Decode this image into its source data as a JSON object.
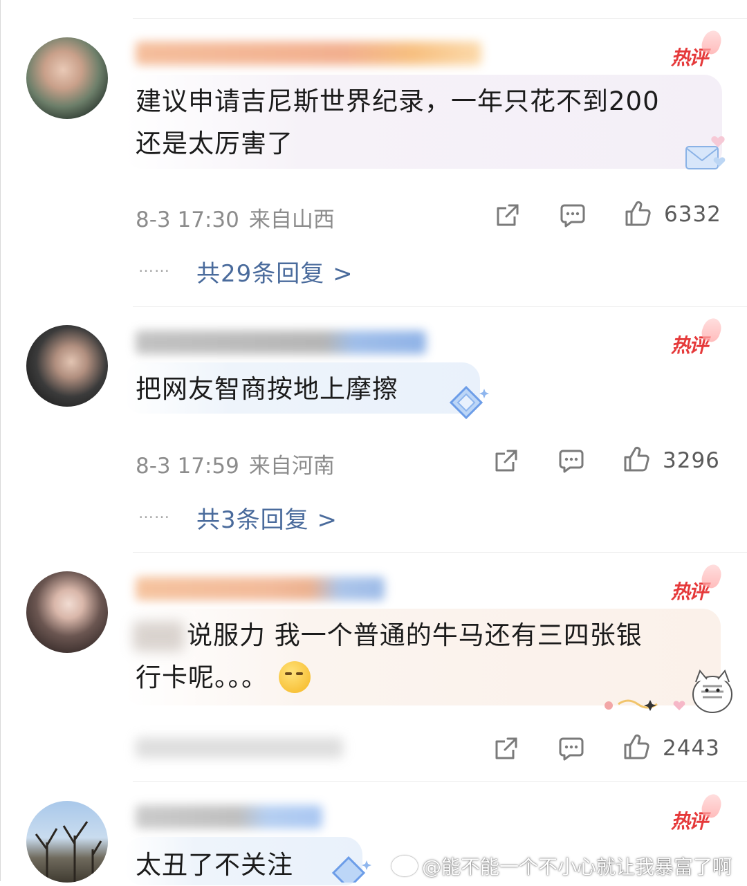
{
  "colors": {
    "hot_badge": "#e5393a",
    "reply_link": "#4a6b9c",
    "meta_text": "#8c8c8c"
  },
  "comments": [
    {
      "hot_label": "热评",
      "text": "建议申请吉尼斯世界纪录，一年只花不到200还是太厉害了",
      "text_line1": "建议申请吉尼斯世界纪录，一年只花不到200",
      "text_line2": "还是太厉害了",
      "date": "8-3 17:30",
      "location": "来自山西",
      "likes": "6332",
      "replies_label": "共29条回复 >"
    },
    {
      "hot_label": "热评",
      "text": "把网友智商按地上摩擦",
      "date": "8-3 17:59",
      "location": "来自河南",
      "likes": "3296",
      "replies_label": "共3条回复 >"
    },
    {
      "hot_label": "热评",
      "text_line1_visible": "说服力 我一个普通的牛马还有三四张银",
      "text_line2": "行卡呢。。。",
      "emoji": "thinking-face-emoji",
      "likes": "2443"
    },
    {
      "hot_label": "热评",
      "text": "太丑了不关注"
    }
  ],
  "dots": "……",
  "watermark": "@能不能一个不小心就让我暴富了啊",
  "icons": [
    "share-icon",
    "comment-icon",
    "like-icon"
  ]
}
